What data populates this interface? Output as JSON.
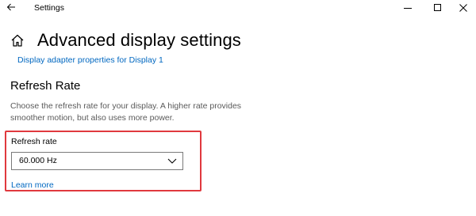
{
  "window": {
    "title": "Settings"
  },
  "header": {
    "title": "Advanced display settings",
    "adapter_link": "Display adapter properties for Display 1"
  },
  "refresh_rate": {
    "heading": "Refresh Rate",
    "description": "Choose the refresh rate for your display. A higher rate provides smoother motion, but also uses more power.",
    "field_label": "Refresh rate",
    "selected_value": "60.000 Hz",
    "learn_more": "Learn more"
  },
  "colors": {
    "link": "#0067c0",
    "highlight": "#e0393e"
  },
  "icons": {
    "back": "back-arrow-icon",
    "home": "home-icon",
    "minimize": "minimize-icon",
    "maximize": "maximize-icon",
    "close": "close-icon",
    "dropdown": "chevron-down-icon"
  }
}
